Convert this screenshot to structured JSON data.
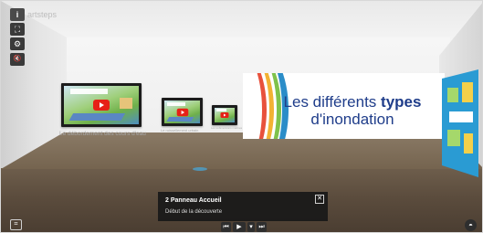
{
  "brand": {
    "text": "artsteps"
  },
  "toolbar": {
    "info_icon": "i",
    "fullscreen_icon": "⛶",
    "settings_icon": "⚙",
    "audio_icon": "🔇"
  },
  "artworks": [
    {
      "caption": "Le débordement des cours d'eau"
    },
    {
      "caption": "Le ruissellement urbain"
    },
    {
      "caption": "Les submersions marines"
    }
  ],
  "panel": {
    "title_part1": "Les différents ",
    "title_bold": "types",
    "title_part2": "d'inondation"
  },
  "info_box": {
    "name": "2 Panneau Accueil",
    "description": "Début de la découverte",
    "close_icon": "✕"
  },
  "player": {
    "prev_icon": "⏮",
    "play_icon": "▶",
    "speed_icon": "▾",
    "next_icon": "⏭"
  },
  "bottom": {
    "tour_icon": "⌗",
    "navigation_icon": "◓"
  }
}
